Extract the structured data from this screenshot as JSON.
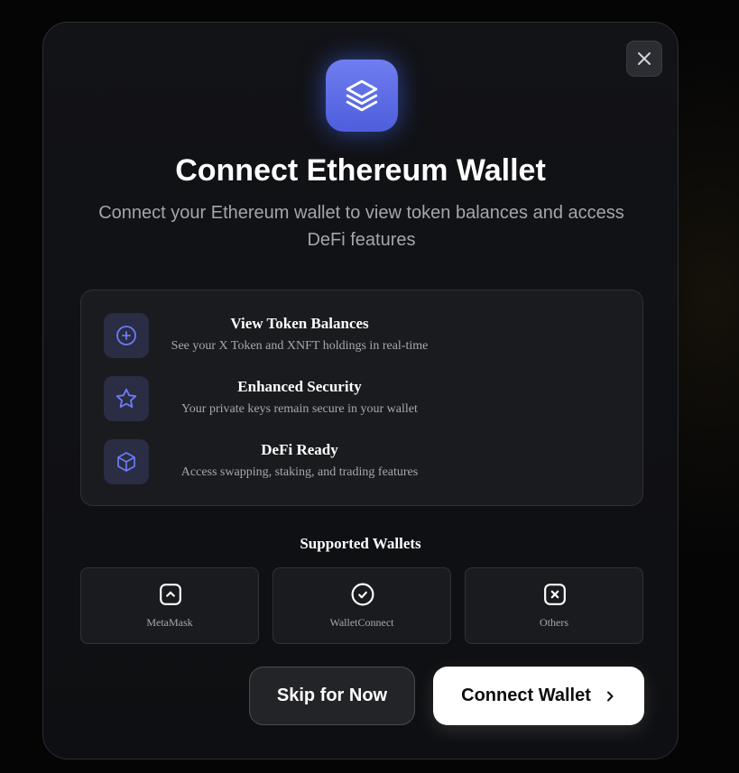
{
  "modal": {
    "title": "Connect Ethereum Wallet",
    "subtitle": "Connect your Ethereum wallet to view token balances and access DeFi features",
    "logo_icon": "layers-icon",
    "close_icon": "close-icon"
  },
  "features": [
    {
      "icon": "plus-circle-icon",
      "title": "View Token Balances",
      "description": "See your X Token and XNFT holdings in real-time"
    },
    {
      "icon": "star-icon",
      "title": "Enhanced Security",
      "description": "Your private keys remain secure in your wallet"
    },
    {
      "icon": "cube-icon",
      "title": "DeFi Ready",
      "description": "Access swapping, staking, and trading features"
    }
  ],
  "supported": {
    "title": "Supported Wallets",
    "wallets": [
      {
        "label": "MetaMask",
        "icon": "chevron-up-square-icon"
      },
      {
        "label": "WalletConnect",
        "icon": "check-circle-icon"
      },
      {
        "label": "Others",
        "icon": "x-square-icon"
      }
    ]
  },
  "actions": {
    "skip_label": "Skip for Now",
    "connect_label": "Connect Wallet",
    "connect_icon": "chevron-right-icon"
  },
  "colors": {
    "accent": "#5b6be6",
    "icon_tint": "#6b7cf5",
    "background": "#0f1013",
    "card": "#1a1b1f"
  }
}
